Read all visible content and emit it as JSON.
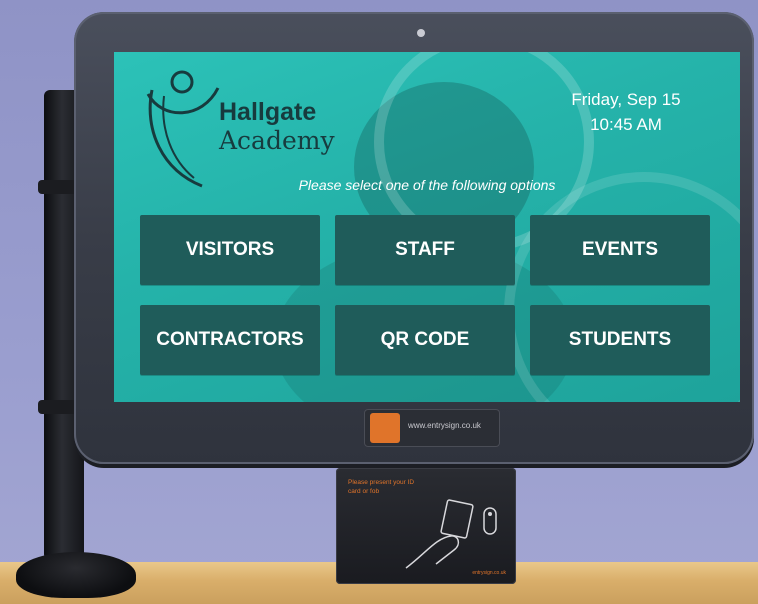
{
  "school": {
    "name": "Hallgate",
    "subtitle": "Academy"
  },
  "clock": {
    "date": "Friday, Sep 15",
    "time": "10:45 AM"
  },
  "prompt": "Please select one of the following options",
  "options": [
    "VISITORS",
    "STAFF",
    "EVENTS",
    "CONTRACTORS",
    "QR CODE",
    "STUDENTS"
  ],
  "dock": {
    "url": "www.entrysign.co.uk"
  },
  "reader": {
    "instruction": "Please present your ID card or fob",
    "brand": "entrysign.co.uk"
  },
  "colors": {
    "screen": "#25b3aa",
    "button": "#1f5c5a",
    "bezel": "#393d48",
    "brand": "#e0742a"
  }
}
